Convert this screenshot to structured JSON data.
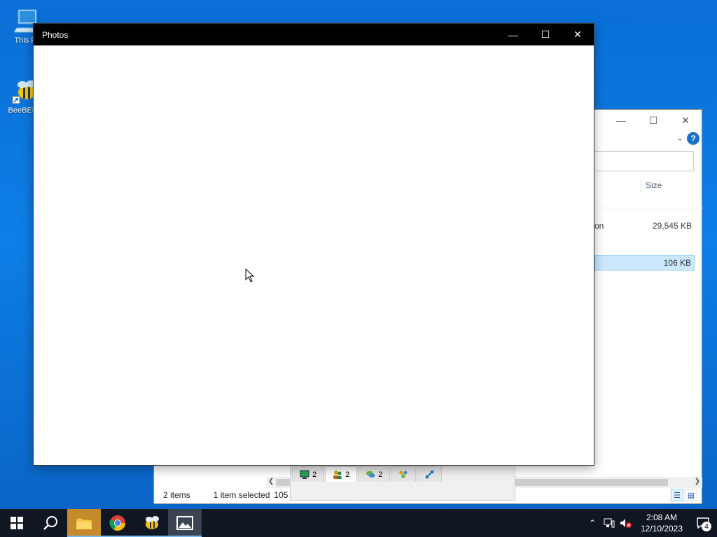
{
  "desktop": {
    "icons": [
      {
        "label": "This PC"
      },
      {
        "label": "BeeBEEP"
      }
    ]
  },
  "explorer": {
    "column_size": "Size",
    "row1_type_fragment": "on",
    "row1_size": "29,545 KB",
    "row2_size": "106 KB",
    "status_items": "2 items",
    "status_selected": "1 item selected",
    "status_size": "105 KB",
    "help": "?"
  },
  "beebeep": {
    "tabs": [
      {
        "count": "2"
      },
      {
        "count": "2"
      },
      {
        "count": "2"
      }
    ]
  },
  "photos": {
    "title": "Photos"
  },
  "taskbar": {
    "time": "2:08 AM",
    "date": "12/10/2023",
    "notifications": "4"
  },
  "colors": {
    "desktop_blue": "#0a6fd6",
    "selection": "#cce8ff",
    "taskbar": "#101722"
  }
}
